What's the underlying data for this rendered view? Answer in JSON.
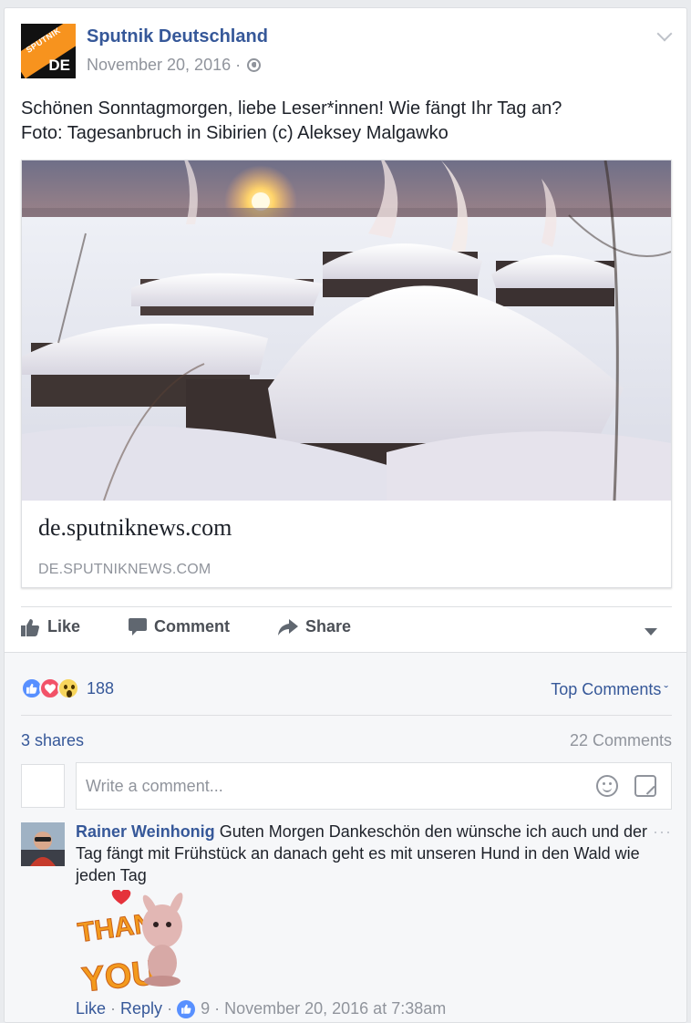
{
  "post": {
    "page_name": "Sputnik Deutschland",
    "avatar": {
      "line1": "SPUTNIK",
      "line2": "DE"
    },
    "date": "November 20, 2016",
    "meta_separator": "·",
    "audience_icon": "globe-icon",
    "text_line1": "Schönen Sonntagmorgen, liebe Leser*innen! Wie fängt Ihr Tag an?",
    "text_line2": "Foto: Tagesanbruch in Sibirien (c) Aleksey Malgawko"
  },
  "link_preview": {
    "title": "de.sputniknews.com",
    "domain": "DE.SPUTNIKNEWS.COM"
  },
  "actions": {
    "like": "Like",
    "comment": "Comment",
    "share": "Share"
  },
  "stats": {
    "reaction_icons": [
      "like-icon",
      "love-icon",
      "wow-icon"
    ],
    "reaction_count": "188",
    "sort_label": "Top Comments",
    "shares": "3 shares",
    "comments": "22 Comments"
  },
  "composer": {
    "placeholder": "Write a comment..."
  },
  "comment": {
    "author": "Rainer Weinhonig",
    "text": "Guten Morgen Dankeschön den wünsche ich auch und der Tag fängt mit Frühstück an danach geht es mit unseren Hund in den Wald wie jeden Tag",
    "sticker_line1": "THANK",
    "sticker_line2": "YOU!",
    "like_label": "Like",
    "reply_label": "Reply",
    "dot": "·",
    "likes": "9",
    "timestamp": "November 20, 2016 at 7:38am",
    "more": "···"
  },
  "colors": {
    "link_blue": "#365899",
    "muted": "#90949c",
    "brand_orange": "#f7931e",
    "like_blue": "#5890ff",
    "love_red": "#f25268",
    "wow_yellow": "#f7d55c"
  }
}
